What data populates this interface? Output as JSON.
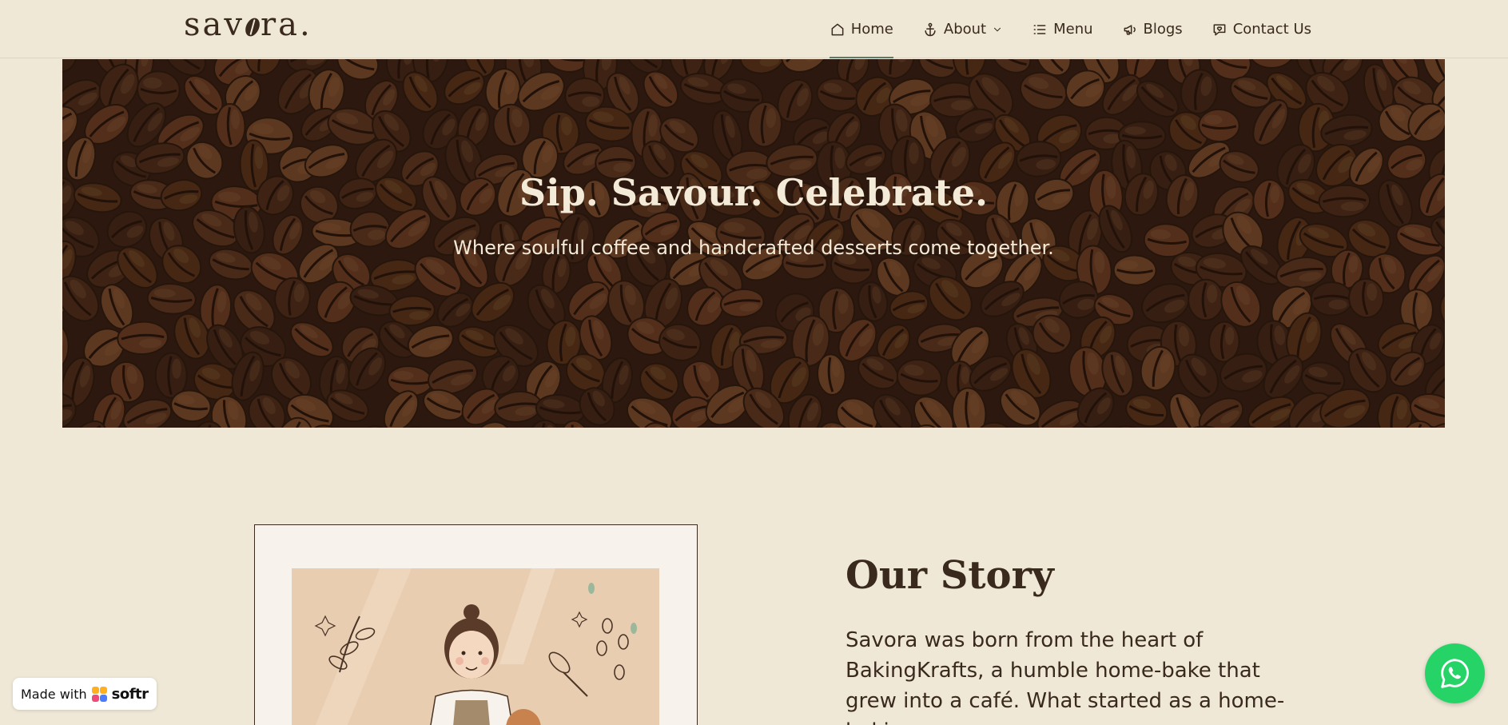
{
  "brand": {
    "logo_prefix": "sav",
    "logo_suffix": "ra."
  },
  "nav": {
    "items": [
      {
        "label": "Home",
        "icon": "home-icon",
        "active": true
      },
      {
        "label": "About",
        "icon": "anchor-icon",
        "has_dropdown": true
      },
      {
        "label": "Menu",
        "icon": "list-icon"
      },
      {
        "label": "Blogs",
        "icon": "megaphone-icon"
      },
      {
        "label": "Contact Us",
        "icon": "chat-heart-icon"
      }
    ]
  },
  "hero": {
    "title": "Sip. Savour. Celebrate.",
    "subtitle": "Where soulful coffee and handcrafted desserts come together."
  },
  "story": {
    "title": "Our Story",
    "text": "Savora was born from the heart of BakingKrafts, a humble home-bake that grew into a café. What started as a home-baking"
  },
  "badge": {
    "made_with": "Made with",
    "brand": "softr"
  },
  "colors": {
    "background": "#efe8d7",
    "text": "#3a2a1e",
    "hero_text": "#f4ead8",
    "active_underline": "#5a7a6a",
    "whatsapp": "#25d366"
  }
}
